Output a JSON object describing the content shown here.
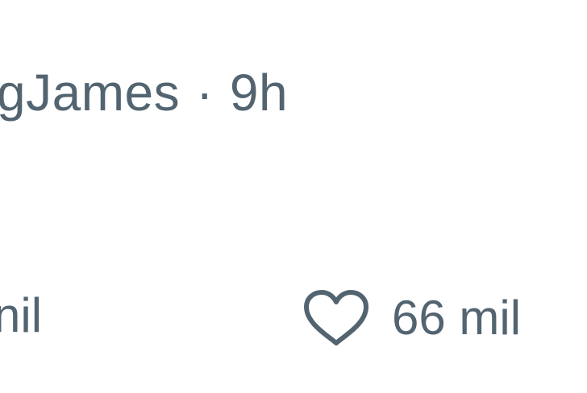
{
  "header": {
    "handle_fragment": "gJames",
    "separator": "·",
    "timestamp": "9h"
  },
  "actions": {
    "retweet_count_fragment": "nil",
    "like_icon": "heart-icon",
    "like_count": "66 mil"
  },
  "colors": {
    "text_secondary": "#536471",
    "background": "#ffffff"
  }
}
